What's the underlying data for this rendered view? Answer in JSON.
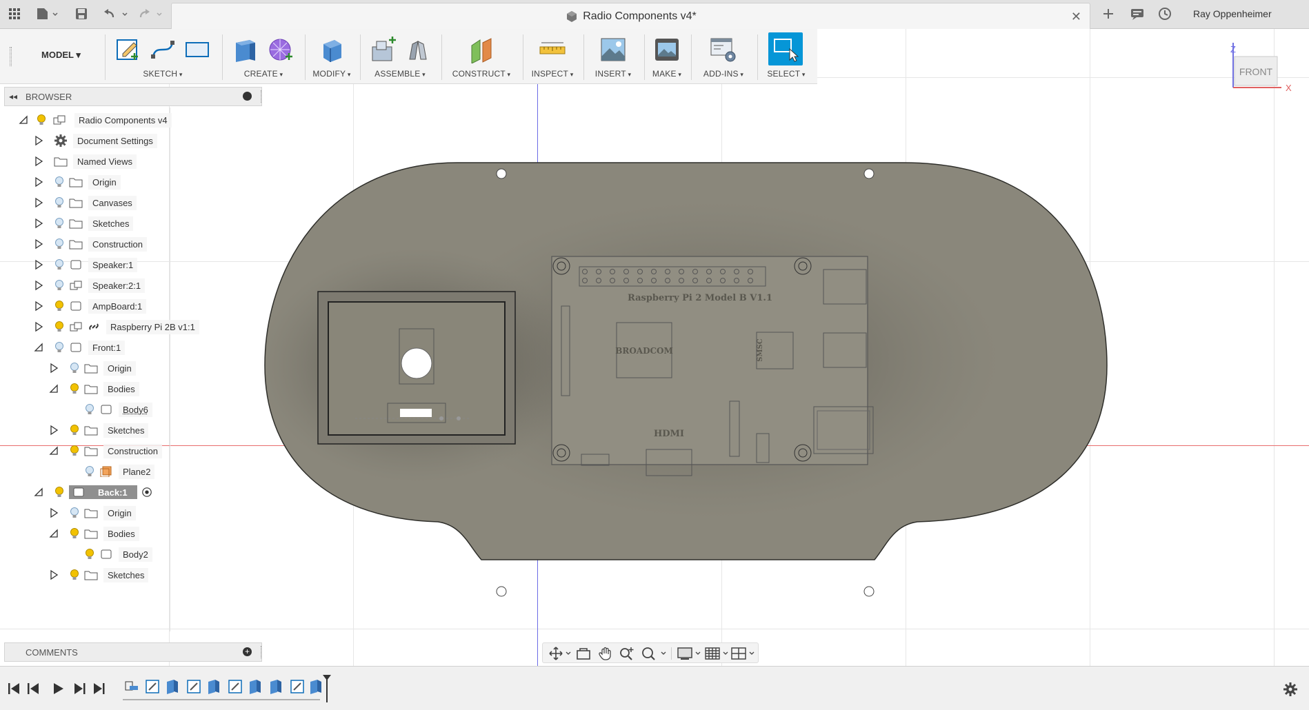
{
  "titlebar": {
    "document_title": "Radio Components v4*",
    "user_name": "Ray Oppenheimer"
  },
  "toolbar": {
    "workspace": "MODEL",
    "groups": [
      {
        "label": "SKETCH"
      },
      {
        "label": "CREATE"
      },
      {
        "label": "MODIFY"
      },
      {
        "label": "ASSEMBLE"
      },
      {
        "label": "CONSTRUCT"
      },
      {
        "label": "INSPECT"
      },
      {
        "label": "INSERT"
      },
      {
        "label": "MAKE"
      },
      {
        "label": "ADD-INS"
      },
      {
        "label": "SELECT"
      }
    ]
  },
  "browser": {
    "title": "BROWSER",
    "items": [
      {
        "label": "Radio Components v4"
      },
      {
        "label": "Document Settings"
      },
      {
        "label": "Named Views"
      },
      {
        "label": "Origin"
      },
      {
        "label": "Canvases"
      },
      {
        "label": "Sketches"
      },
      {
        "label": "Construction"
      },
      {
        "label": "Speaker:1"
      },
      {
        "label": "Speaker:2:1"
      },
      {
        "label": "AmpBoard:1"
      },
      {
        "label": "Raspberry Pi 2B v1:1"
      },
      {
        "label": "Front:1"
      },
      {
        "label": "Origin"
      },
      {
        "label": "Bodies"
      },
      {
        "label": "Body6"
      },
      {
        "label": "Sketches"
      },
      {
        "label": "Construction"
      },
      {
        "label": "Plane2"
      },
      {
        "label": "Back:1"
      },
      {
        "label": "Origin"
      },
      {
        "label": "Bodies"
      },
      {
        "label": "Body2"
      },
      {
        "label": "Sketches"
      }
    ]
  },
  "comments": {
    "title": "COMMENTS"
  },
  "viewcube": {
    "face": "FRONT",
    "axis_z": "Z",
    "axis_x": "X"
  },
  "model": {
    "board_label": "Raspberry Pi 2 Model B V1.1",
    "chip_label": "BROADCOM",
    "smsc_label": "SMSC",
    "hdmi_label": "HDMI"
  },
  "colors": {
    "accent": "#0696d7",
    "plate": "#8a877b",
    "bulb": "#f2c200"
  }
}
